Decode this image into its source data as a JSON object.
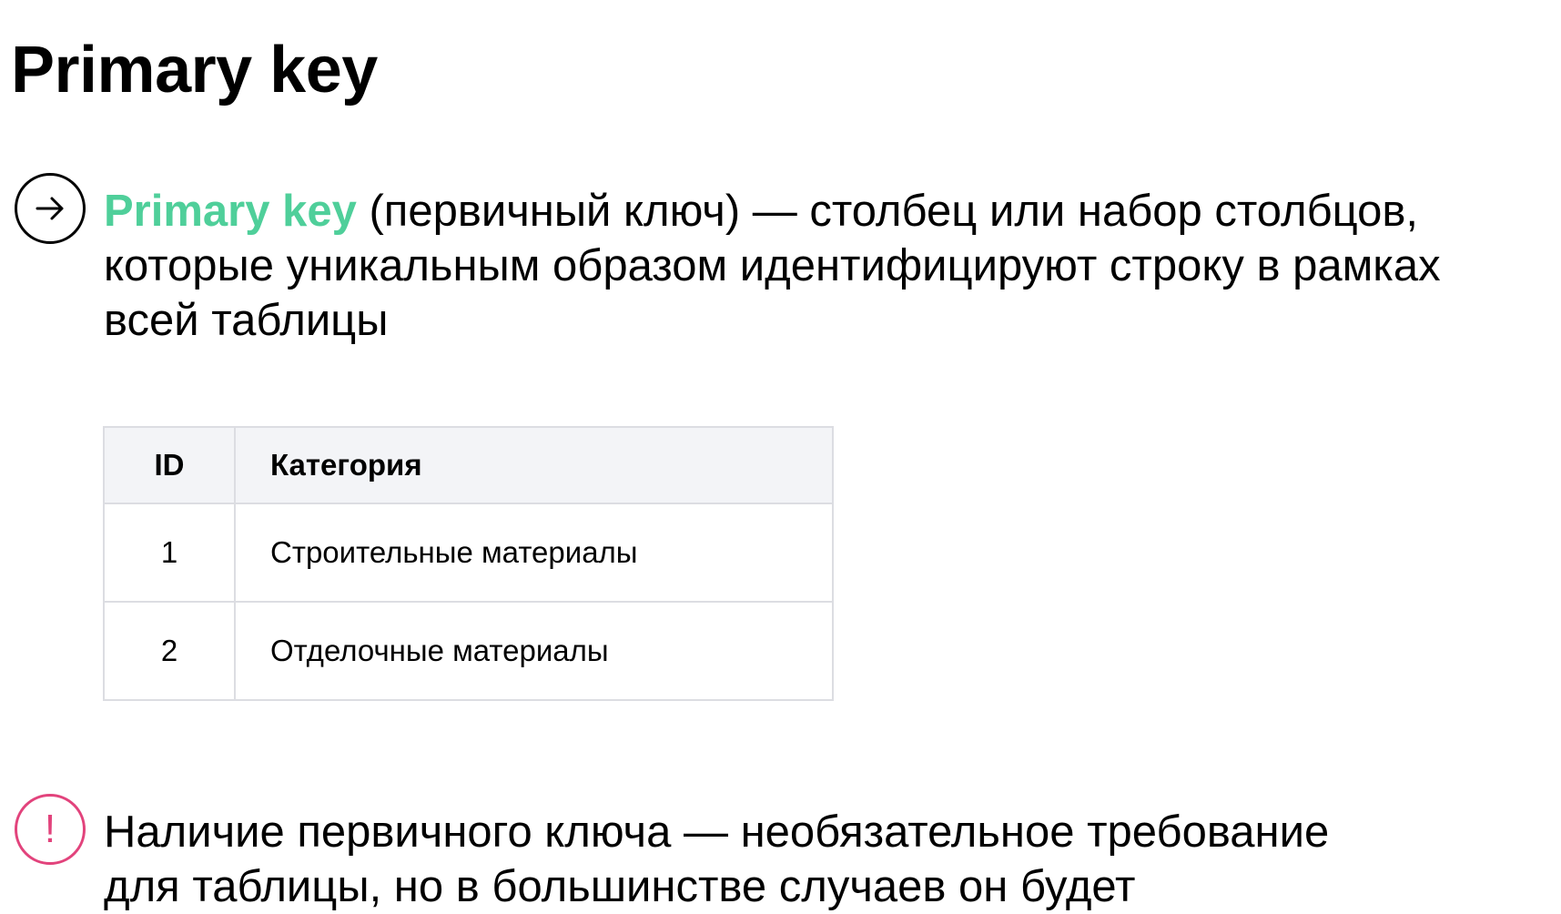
{
  "title": "Primary key",
  "definition": {
    "term": "Primary key",
    "line1_rest": " (первичный ключ) — столбец или набор столбцов,",
    "line2": "которые уникальным образом идентифицируют строку в рамках",
    "line3": "всей таблицы",
    "icon": "arrow-right-icon"
  },
  "table": {
    "headers": [
      "ID",
      "Категория"
    ],
    "rows": [
      [
        "1",
        "Строительные материалы"
      ],
      [
        "2",
        "Отделочные материалы"
      ]
    ]
  },
  "note": {
    "icon_glyph": "!",
    "icon": "exclamation-icon",
    "line1": "Наличие первичного ключа — необязательное требование",
    "line2": "для таблицы, но в большинстве случаев он будет"
  },
  "colors": {
    "accent_green": "#4fcf9a",
    "warning_pink": "#e2437c",
    "header_bg": "#f3f4f7",
    "border": "#dcdde2"
  }
}
